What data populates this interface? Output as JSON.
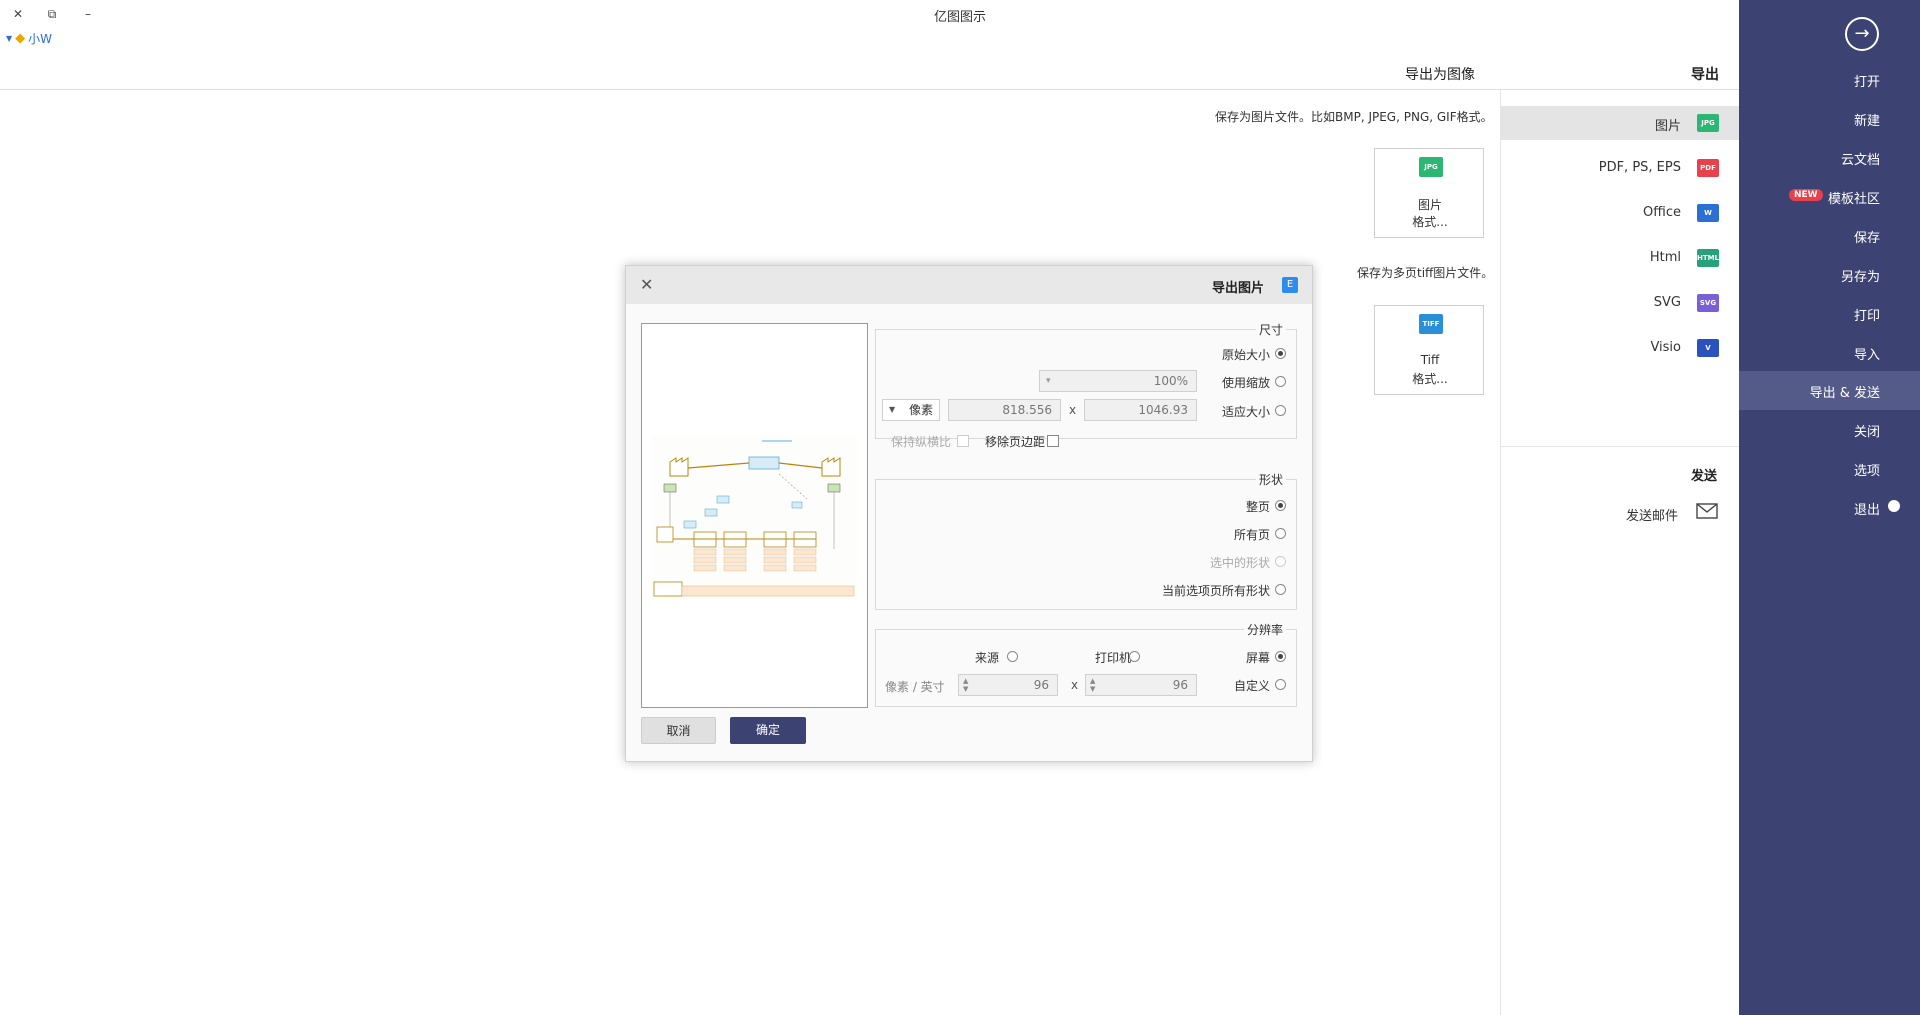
{
  "window": {
    "title": "亿图图示",
    "user_label": "小W",
    "close_glyph": "✕",
    "restore_glyph": "⧉",
    "minimize_glyph": "–"
  },
  "header": {
    "export_heading": "导出",
    "export_as_image": "导出为图像"
  },
  "sidebar": {
    "back_glyph": "→",
    "items": [
      {
        "label": "打开"
      },
      {
        "label": "新建"
      },
      {
        "label": "云文档"
      },
      {
        "label": "模板社区",
        "badge": "NEW"
      },
      {
        "label": "保存"
      },
      {
        "label": "另存为"
      },
      {
        "label": "打印"
      },
      {
        "label": "导入"
      },
      {
        "label": "导出 & 发送"
      },
      {
        "label": "关闭"
      },
      {
        "label": "选项"
      },
      {
        "label": "退出"
      }
    ],
    "active_index": 8
  },
  "export_types": [
    {
      "label": "图片",
      "icon_text": "JPG",
      "color": "#2bb673"
    },
    {
      "label": "PDF, PS, EPS",
      "icon_text": "PDF",
      "color": "#e8414b"
    },
    {
      "label": "Office",
      "icon_text": "W",
      "color": "#2a6fd6"
    },
    {
      "label": "Html",
      "icon_text": "HTML",
      "color": "#27a17a"
    },
    {
      "label": "SVG",
      "icon_text": "SVG",
      "color": "#7b5fd6"
    },
    {
      "label": "Visio",
      "icon_text": "V",
      "color": "#2a52be"
    }
  ],
  "send": {
    "heading": "发送",
    "mail_label": "发送邮件"
  },
  "content": {
    "desc_image": "保存为图片文件。比如BMP, JPEG, PNG, GIF格式。",
    "desc_tiff": "保存为多页tiff图片文件。",
    "card_image": {
      "name": "图片",
      "sub": "格式...",
      "icon_text": "JPG"
    },
    "card_tiff": {
      "name": "Tiff",
      "sub": "格式...",
      "icon_text": "TIFF"
    }
  },
  "dialog": {
    "title": "导出图片",
    "close_glyph": "✕",
    "size_group": {
      "title": "尺寸",
      "original": "原始大小",
      "use_zoom": "使用缩放",
      "zoom_value": "100%",
      "fit_size": "适应大小",
      "width": "1046.93",
      "height": "818.556",
      "unit": "像素",
      "remove_margin": "移除页边距",
      "keep_ratio": "保持纵横比"
    },
    "shape_group": {
      "title": "形状",
      "whole_page": "整页",
      "all_pages": "所有页",
      "selected_shapes": "选中的形状",
      "current_page_all": "当前选项页所有形状"
    },
    "resolution_group": {
      "title": "分辨率",
      "screen": "屏幕",
      "printer": "打印机",
      "source": "来源",
      "custom": "自定义",
      "dpi_x": "96",
      "dpi_y": "96",
      "dpi_unit": "像素 / 英寸"
    },
    "ok": "确定",
    "cancel": "取消"
  }
}
